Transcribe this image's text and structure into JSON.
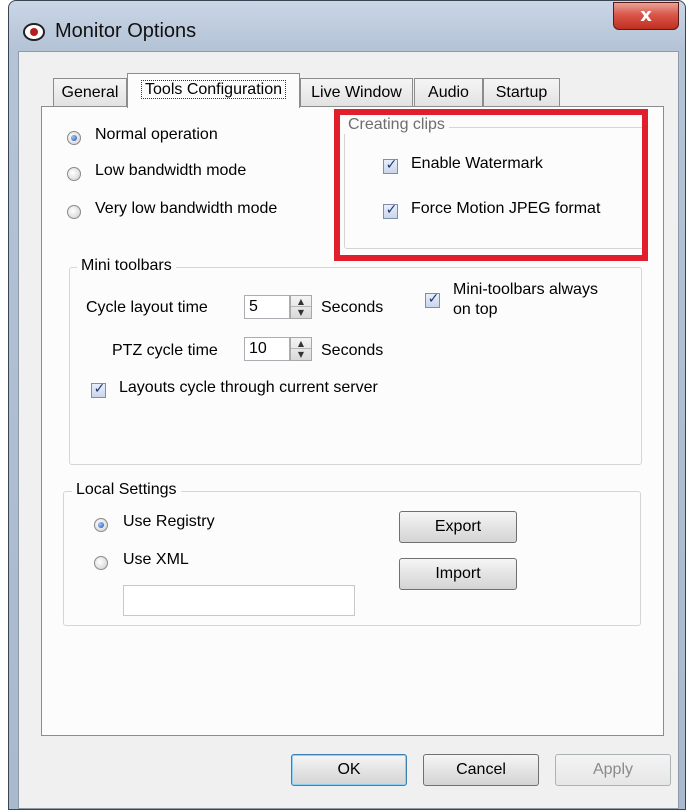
{
  "window": {
    "title": "Monitor Options",
    "close_glyph": "x"
  },
  "tabs": [
    {
      "label": "General"
    },
    {
      "label": "Tools Configuration"
    },
    {
      "label": "Live Window"
    },
    {
      "label": "Audio"
    },
    {
      "label": "Startup"
    }
  ],
  "operation_modes": [
    {
      "label": "Normal operation",
      "selected": true
    },
    {
      "label": "Low bandwidth mode",
      "selected": false
    },
    {
      "label": "Very low bandwidth mode",
      "selected": false
    }
  ],
  "creating_clips": {
    "legend": "Creating clips",
    "enable_watermark": {
      "label": "Enable Watermark",
      "checked": true
    },
    "force_mjpeg": {
      "label": "Force Motion JPEG format",
      "checked": true
    }
  },
  "mini_toolbars": {
    "legend": "Mini toolbars",
    "cycle_layout_label": "Cycle layout time",
    "cycle_layout_value": "5",
    "cycle_layout_unit": "Seconds",
    "ptz_cycle_label": "PTZ cycle time",
    "ptz_cycle_value": "10",
    "ptz_cycle_unit": "Seconds",
    "always_on_top_line1": "Mini-toolbars always",
    "always_on_top_line2": "on top",
    "layouts_cycle_label": "Layouts cycle through current server"
  },
  "local_settings": {
    "legend": "Local Settings",
    "use_registry": "Use Registry",
    "use_xml": "Use XML",
    "xml_path": "",
    "export_label": "Export",
    "import_label": "Import"
  },
  "footer": {
    "ok_label": "OK",
    "cancel_label": "Cancel",
    "apply_label": "Apply"
  },
  "icons": {
    "check_glyph": "✓",
    "spin_up_glyph": "▲",
    "spin_down_glyph": "▼"
  },
  "colors": {
    "highlight": "#e01e2d",
    "close_button": "#c9402f"
  }
}
